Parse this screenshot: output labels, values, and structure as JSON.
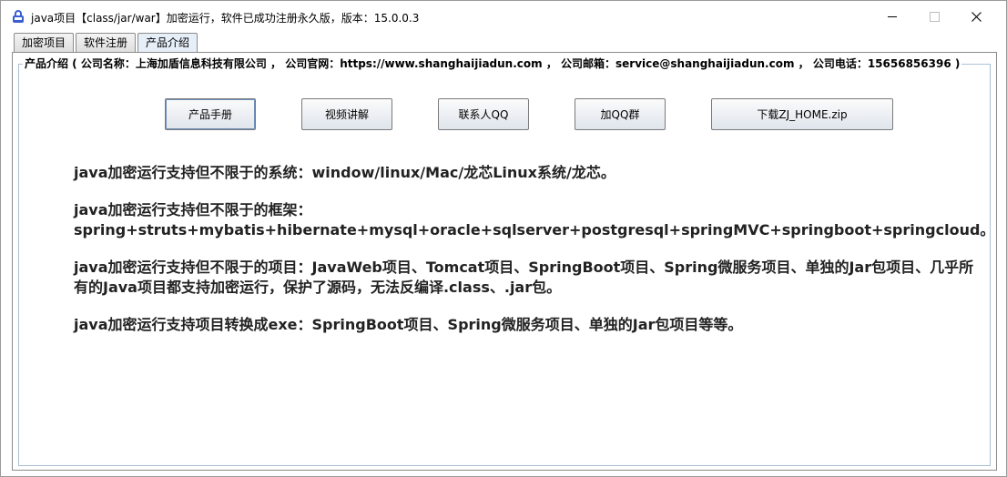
{
  "window": {
    "title": "java项目【class/jar/war】加密运行，软件已成功注册永久版，版本：15.0.0.3",
    "icon": "lock-app-icon",
    "controls": [
      "minimize-icon",
      "maximize-icon",
      "close-icon"
    ]
  },
  "tabs": [
    {
      "label": "加密项目"
    },
    {
      "label": "软件注册"
    },
    {
      "label": "产品介绍",
      "active": true
    }
  ],
  "panel": {
    "legend": "产品介绍 ( 公司名称：上海加盾信息科技有限公司 ， 公司官网：https://www.shanghaijiadun.com ， 公司邮箱：service@shanghaijiadun.com ， 公司电话：15656856396 )",
    "buttons": [
      {
        "label": "产品手册"
      },
      {
        "label": "视频讲解"
      },
      {
        "label": "联系人QQ"
      },
      {
        "label": "加QQ群"
      },
      {
        "label": "下载ZJ_HOME.zip"
      }
    ],
    "paragraphs": [
      "java加密运行支持但不限于的系统：window/linux/Mac/龙芯Linux系统/龙芯。",
      "java加密运行支持但不限于的框架：\nspring+struts+mybatis+hibernate+mysql+oracle+sqlserver+postgresql+springMVC+springboot+springcloud。",
      "java加密运行支持但不限于的项目：JavaWeb项目、Tomcat项目、SpringBoot项目、Spring微服务项目、单独的Jar包项目、几乎所有的Java项目都支持加密运行，保护了源码，无法反编译.class、.jar包。",
      "java加密运行支持项目转换成exe：SpringBoot项目、Spring微服务项目、单独的Jar包项目等等。"
    ]
  },
  "colors": {
    "accent": "#a9bfd6",
    "text": "#222222"
  }
}
